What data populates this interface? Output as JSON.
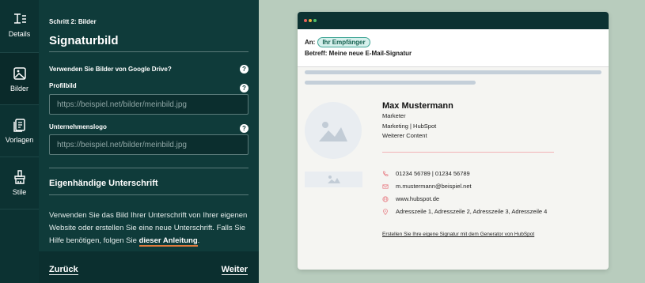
{
  "rail": {
    "items": [
      {
        "label": "Details",
        "icon": "details-icon"
      },
      {
        "label": "Bilder",
        "icon": "image-icon"
      },
      {
        "label": "Vorlagen",
        "icon": "templates-icon"
      },
      {
        "label": "Stile",
        "icon": "brush-icon"
      }
    ]
  },
  "panel": {
    "step": "Schritt 2: Bilder",
    "title": "Signaturbild",
    "google_drive_label": "Verwenden Sie Bilder von Google Drive?",
    "profile_label": "Profilbild",
    "profile_placeholder": "https://beispiel.net/bilder/meinbild.jpg",
    "logo_label": "Unternehmenslogo",
    "logo_placeholder": "https://beispiel.net/bilder/meinbild.jpg",
    "signature_title": "Eigenhändige Unterschrift",
    "paragraph": "Verwenden Sie das Bild Ihrer Unterschrift von Ihrer eigenen Website oder erstellen Sie eine neue Unterschrift. Falls Sie Hilfe benötigen, folgen Sie",
    "guide_link": "dieser Anleitung",
    "paragraph_end": ".",
    "help_glyph": "?",
    "back": "Zurück",
    "next": "Weiter"
  },
  "preview": {
    "to_label": "An:",
    "recipient": "Ihr Empfänger",
    "subject": "Betreff: Meine neue E-Mail-Signatur",
    "name": "Max Mustermann",
    "job": "Marketer",
    "dept_company": "Marketing | HubSpot",
    "extra": "Weiterer Content",
    "phone": "01234 56789 | 01234 56789",
    "email": "m.mustermann@beispiel.net",
    "website": "www.hubspot.de",
    "address": "Adresszeile 1, Adresszeile 2, Adresszeile 3, Adresszeile 4",
    "generator_link": "Erstellen Sie Ihre eigene Signatur mit dem Generator von HubSpot"
  },
  "colors": {
    "rail_bg": "#0c3232",
    "panel_bg": "#0f3b3a",
    "accent_orange": "#e07a3c",
    "pill_green": "#3fa596",
    "contact_icon": "#e8868d",
    "dot_red": "#e8625b",
    "dot_yellow": "#e9b43c",
    "dot_green": "#4fbf6a"
  }
}
